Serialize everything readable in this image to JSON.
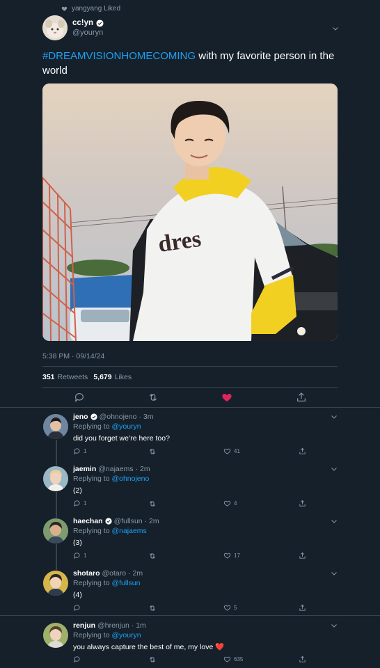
{
  "social_context": {
    "text": "yangyang Liked"
  },
  "tweet": {
    "name": "cc!yn",
    "handle": "@youryn",
    "hashtag": "#DREAMVISIONHOMECOMING",
    "text_rest": " with my favorite person in the world",
    "timestamp": "5:38 PM · 09/14/24",
    "retweets": "351",
    "retweets_label": "Retweets",
    "likes": "5,679",
    "likes_label": "Likes",
    "photo_text": "Padres jersey"
  },
  "replies": [
    {
      "name": "jeno",
      "verified": true,
      "handle": "@ohnojeno",
      "time": "· 3m",
      "replying_prefix": "Replying to",
      "replying_to": "@youryn",
      "text": "did you forget we’re here too?",
      "replies": "1",
      "likes": "41"
    },
    {
      "name": "jaemin",
      "verified": false,
      "handle": "@najaems",
      "time": "· 2m",
      "replying_prefix": "Replying to",
      "replying_to": "@ohnojeno",
      "text": "(2)",
      "replies": "1",
      "likes": "4"
    },
    {
      "name": "haechan",
      "verified": true,
      "handle": "@fullsun",
      "time": "· 2m",
      "replying_prefix": "Replying to",
      "replying_to": "@najaems",
      "text": "(3)",
      "replies": "1",
      "likes": "17"
    },
    {
      "name": "shotaro",
      "verified": false,
      "handle": "@otaro",
      "time": "· 2m",
      "replying_prefix": "Replying to",
      "replying_to": "@fullsun",
      "text": "(4)",
      "replies": "",
      "likes": "5"
    },
    {
      "name": "renjun",
      "verified": false,
      "handle": "@hrenjun",
      "time": "· 1m",
      "replying_prefix": "Replying to",
      "replying_to": "@youryn",
      "text": "you always capture the best of me, my love ❤️",
      "replies": "",
      "likes": "635"
    }
  ],
  "colors": {
    "background": "#15202b",
    "link": "#1da1f2",
    "muted": "#8899a6",
    "like_active": "#e0245e",
    "divider": "#38444d"
  },
  "icons": [
    "heart-icon",
    "verified-badge-icon",
    "chevron-down-icon",
    "reply-icon",
    "retweet-icon",
    "like-icon",
    "share-icon"
  ]
}
